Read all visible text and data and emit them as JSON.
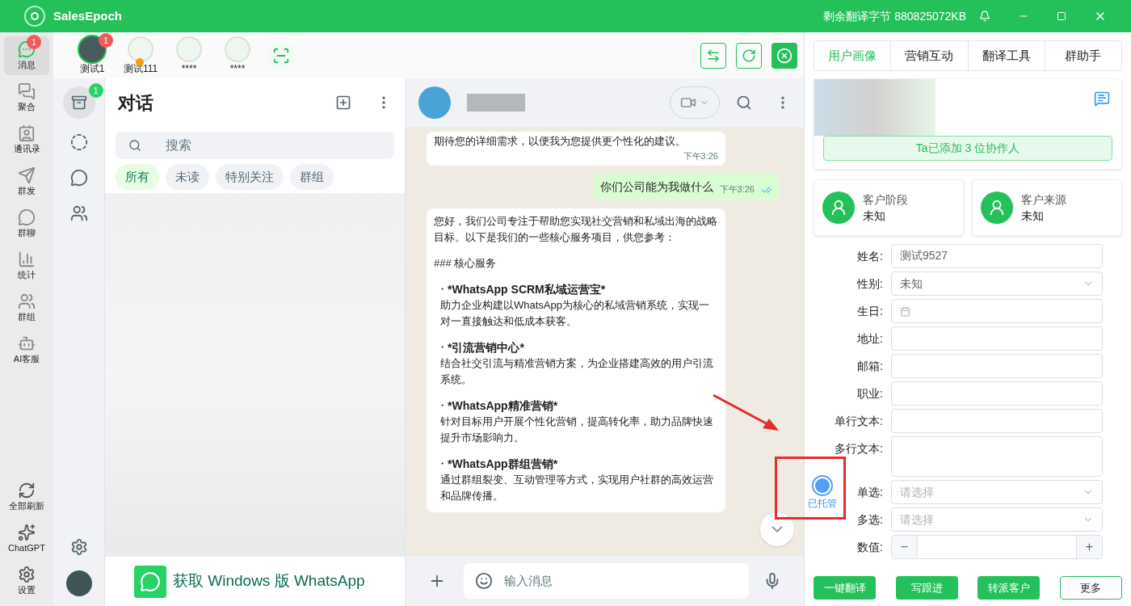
{
  "titlebar": {
    "app_name": "SalesEpoch",
    "quota": "剩余翻译字节 880825072KB"
  },
  "nav": [
    {
      "label": "消息",
      "selected": true,
      "badge": "1"
    },
    {
      "label": "聚合",
      "selected": false
    },
    {
      "label": "通讯录",
      "selected": false
    },
    {
      "label": "群发",
      "selected": false
    },
    {
      "label": "群聊",
      "selected": false
    },
    {
      "label": "统计",
      "selected": false
    },
    {
      "label": "群组",
      "selected": false
    },
    {
      "label": "AI客服",
      "selected": false
    }
  ],
  "nav_bottom": [
    {
      "label": "全部刷新"
    },
    {
      "label": "ChatGPT"
    },
    {
      "label": "设置"
    }
  ],
  "accounts": [
    {
      "name": "测试1",
      "selected": true,
      "badge": "1"
    },
    {
      "name": "测试111",
      "selected": false,
      "color": "#f59e0b"
    },
    {
      "name": "****",
      "selected": false
    },
    {
      "name": "****",
      "selected": false
    }
  ],
  "rail": {
    "chats_badge": "1"
  },
  "chat_list": {
    "title": "对话",
    "search_placeholder": "搜索",
    "filters": [
      {
        "label": "所有",
        "selected": true
      },
      {
        "label": "未读",
        "selected": false
      },
      {
        "label": "特别关注",
        "selected": false
      },
      {
        "label": "群组",
        "selected": false
      }
    ],
    "promo": "获取 Windows 版 WhatsApp"
  },
  "chat": {
    "messages": [
      {
        "kind": "incoming_tail",
        "text": "期待您的详细需求，以便我为您提供更个性化的建议。",
        "time": "下午3:26"
      },
      {
        "kind": "outgoing",
        "text": "你们公司能为我做什么",
        "time": "下午3:26",
        "read": true
      },
      {
        "kind": "incoming",
        "blocks": [
          {
            "kind": "p",
            "text": "您好，我们公司专注于帮助您实现社交营销和私域出海的战略目标。以下是我们的一些核心服务项目，供您参考："
          },
          {
            "kind": "p",
            "text": "### 核心服务"
          },
          {
            "kind": "item",
            "marker": "・",
            "title": "*WhatsApp SCRM私域运营宝*",
            "text": "助力企业构建以WhatsApp为核心的私域营销系统，实现一对一直接触达和低成本获客。"
          },
          {
            "kind": "item",
            "marker": "・",
            "title": "*引流营销中心*",
            "text": "结合社交引流与精准营销方案，为企业搭建高效的用户引流系统。"
          },
          {
            "kind": "item",
            "marker": "・",
            "title": "*WhatsApp精准营销*",
            "text": "针对目标用户开展个性化营销，提高转化率，助力品牌快速提升市场影响力。"
          },
          {
            "kind": "item",
            "marker": "・",
            "title": "*WhatsApp群组营销*",
            "text": "通过群组裂变、互动管理等方式，实现用户社群的高效运营和品牌传播。"
          }
        ]
      }
    ],
    "composer_placeholder": "输入消息",
    "ai_badge": "已托管"
  },
  "panel": {
    "tabs": [
      {
        "label": "用户画像",
        "selected": true
      },
      {
        "label": "营销互动",
        "selected": false
      },
      {
        "label": "翻译工具",
        "selected": false
      },
      {
        "label": "群助手",
        "selected": false
      }
    ],
    "collaborators": "Ta已添加 3 位协作人",
    "stats": [
      {
        "label": "客户阶段",
        "value": "未知"
      },
      {
        "label": "客户来源",
        "value": "未知"
      }
    ],
    "fields": [
      {
        "label": "姓名:",
        "kind": "text",
        "value": "测试9527"
      },
      {
        "label": "性别:",
        "kind": "select",
        "value": "未知"
      },
      {
        "label": "生日:",
        "kind": "date"
      },
      {
        "label": "地址:",
        "kind": "text"
      },
      {
        "label": "邮箱:",
        "kind": "text"
      },
      {
        "label": "职业:",
        "kind": "text"
      },
      {
        "label": "单行文本:",
        "kind": "text"
      },
      {
        "label": "多行文本:",
        "kind": "textarea"
      },
      {
        "label": "单选:",
        "kind": "select",
        "placeholder": "请选择"
      },
      {
        "label": "多选:",
        "kind": "select",
        "placeholder": "请选择"
      },
      {
        "label": "数值:",
        "kind": "number",
        "minus": "−",
        "plus": "+"
      }
    ],
    "actions": [
      {
        "label": "一键翻译",
        "kind": "primary"
      },
      {
        "label": "写跟进",
        "kind": "primary"
      },
      {
        "label": "转派客户",
        "kind": "primary"
      },
      {
        "label": "更多",
        "kind": "outline"
      }
    ]
  }
}
